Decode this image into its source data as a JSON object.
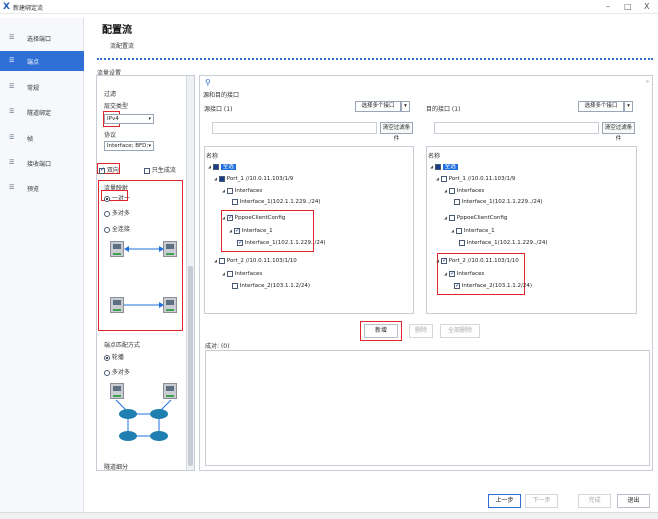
{
  "window": {
    "title": "新建绑定流",
    "min_label": "–",
    "max_label": "□",
    "close_label": "X"
  },
  "sidebar": {
    "items": [
      {
        "label": "选择端口"
      },
      {
        "label": "端点"
      },
      {
        "label": "常规"
      },
      {
        "label": "隧道绑定"
      },
      {
        "label": "帧"
      },
      {
        "label": "接收端口"
      },
      {
        "label": "预览"
      }
    ]
  },
  "header": {
    "title": "配置流",
    "subtitle": "流配置流"
  },
  "left": {
    "group_title": "流量设置",
    "filter_title": "过滤",
    "l3_label": "层交类型",
    "l3_value": "IPv4",
    "proto_label": "协议",
    "proto_value": "Interface; BFD;",
    "bidir_label": "双向",
    "only_label": "只生成流",
    "mapping_title": "流量映射",
    "mapping_options": [
      "一对一",
      "多对多",
      "全连接"
    ],
    "endpoint_title": "端点匹配方式",
    "endpoint_options": [
      "轮播",
      "多对多"
    ],
    "tunnel_label": "隧道细分"
  },
  "main": {
    "section_title": "源和目的接口",
    "src_label": "源接口 (1)",
    "dst_label": "目的接口 (1)",
    "multi_btn": "选择多个接口",
    "clear_btn": "清空过滤条件",
    "col_name": "名称",
    "all_label": "全选",
    "src_tree": [
      "全选",
      "Port_1 //10.0.11.103/1/9",
      "Interfaces",
      "Interface_1(102.1.1.229../24)",
      "PppoeClientConfig",
      "Interface_1",
      "Interface_1(102.1.1.229../24)",
      "Port_2 //10.0.11.103/1/10",
      "Interfaces",
      "Interface_2(103.1.1.2/24)"
    ],
    "dst_tree": [
      "全选",
      "Port_1 //10.0.11.103/1/9",
      "Interfaces",
      "Interface_1(102.1.1.229../24)",
      "PppoeClientConfig",
      "Interface_1",
      "Interface_1(102.1.1.229../24)",
      "Port_2 //10.0.11.103/1/10",
      "Interfaces",
      "Interface_2(103.1.1.2/24)"
    ],
    "add_btn": "新增",
    "del_btn": "删除",
    "del_all_btn": "全部删除",
    "pairs_label": "成对:",
    "pairs_count": "(0)"
  },
  "footer": {
    "prev": "上一步",
    "next": "下一步",
    "finish": "完成",
    "exit": "退出"
  },
  "colors": {
    "accent": "#2f6fd6",
    "highlight": "#e0262b"
  }
}
